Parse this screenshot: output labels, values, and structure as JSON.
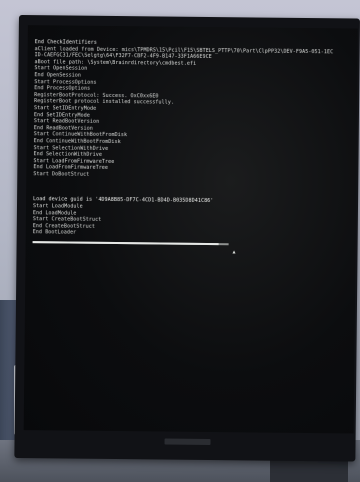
{
  "terminal": {
    "lines_top": [
      "End CheckIdentifiers",
      "aClient loaded from Device: mics\\TPMDRS\\15\\Pcil\\F15\\SBTELS_PTTP\\70\\Part\\ClpPP32\\DEV-F9A5-051-1EC",
      "ID-CAEFGC31/FEC\\Selgtg\\64\\F32F7-CBF2-4F9-B147-33F1A66E9CE",
      "aBoot file path: \\System\\Brainrdirectory\\cmdbest.efi",
      "Start OpenSession",
      "End OpenSession",
      "Start ProcessOptions",
      "End ProcessOptions",
      "RegisterBootProtocol: Success. OxC0xx6E0",
      "RegisterBoot protocol installed successfully.",
      "Start SetIDEntryMode",
      "End SetIDEntryMode",
      "Start ReadBootVersion",
      "End ReadBootVersion",
      "Start ContinueWithBootFromDisk",
      "End ContinueWithBootFromDisk",
      "Start SelectionWithDrive",
      "End SelectionWithDrive",
      "Start LoadFromFirmwareTree",
      "End LoadFromFirmwareTree",
      "Start DoBootStruct"
    ],
    "lines_bottom": [
      "Load device guid is '4D9A8B85-DF7C-4CD1-BD4D-B035D8D41C86'",
      "Start LoadModule",
      "End LoadModule",
      "Start CreateBootStruct",
      "End CreateBootStruct",
      "End BootLoader"
    ],
    "progress_fraction": 0.95,
    "cursor_glyph": "▲"
  }
}
